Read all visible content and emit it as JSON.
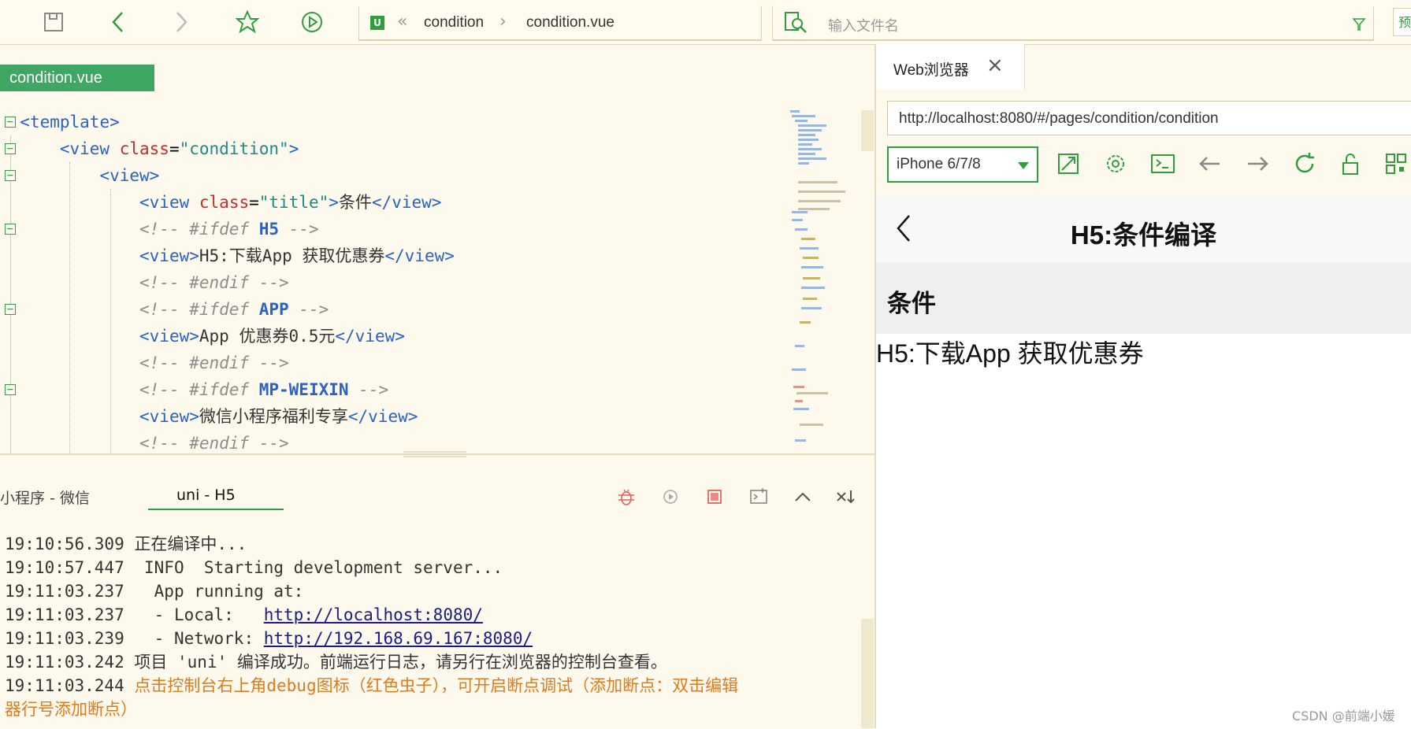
{
  "toolbar": {
    "breadcrumb": [
      "condition",
      "condition.vue"
    ],
    "file_search_placeholder": "输入文件名"
  },
  "editor": {
    "tab_label": "condition.vue"
  },
  "console": {
    "tabs": [
      "小程序 - 微信",
      "uni - H5"
    ],
    "lines": [
      {
        "time": "19:10:56.309",
        "text": "正在编译中..."
      },
      {
        "time": "19:10:57.447",
        "text": " INFO  Starting development server..."
      },
      {
        "time": "19:11:03.237",
        "text": "  App running at:"
      },
      {
        "time": "19:11:03.237",
        "text": "  - Local:   ",
        "link": "http://localhost:8080/"
      },
      {
        "time": "19:11:03.239",
        "text": "  - Network: ",
        "link": "http://192.168.69.167:8080/"
      },
      {
        "time": "19:11:03.242",
        "text": "项目 'uni' 编译成功。前端运行日志，请另行在浏览器的控制台查看。"
      },
      {
        "time": "19:11:03.244",
        "text": "点击控制台右上角debug图标（红色虫子），可开启断点调试（添加断点：双击编辑",
        "cont": "器行号添加断点）"
      }
    ]
  },
  "browser": {
    "tab_label": "Web浏览器",
    "url": "http://localhost:8080/#/pages/condition/condition",
    "device": "iPhone 6/7/8",
    "nav_title": "H5:条件编译",
    "section_title": "条件",
    "body_text": "H5:下载App 获取优惠券"
  },
  "watermark": "CSDN @前端小媛",
  "colors": {
    "accent": "#2f9e3e",
    "tab_active": "#3fa663",
    "tag": "#2a62c7",
    "attr": "#c92a2a"
  }
}
